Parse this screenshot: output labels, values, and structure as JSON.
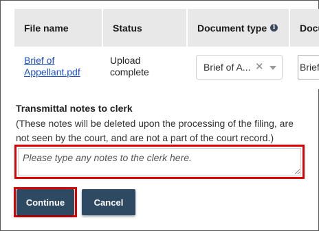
{
  "table": {
    "headers": [
      "File name",
      "Status",
      "Document type",
      "Docu"
    ],
    "rows": [
      {
        "file_name": "Brief of Appellant.pdf",
        "status": "Upload complete",
        "document_type": "Brief of A...",
        "extra": "Brief"
      }
    ]
  },
  "notes": {
    "title": "Transmittal notes to clerk",
    "help": "(These notes will be deleted upon the processing of the filing, are not seen by the court, and are not a part of the court record.)",
    "placeholder": "Please type any notes to the clerk here."
  },
  "buttons": {
    "continue": "Continue",
    "cancel": "Cancel"
  },
  "colors": {
    "button_bg": "#2e4a62",
    "highlight": "#e00000",
    "link": "#1a4fcf"
  }
}
